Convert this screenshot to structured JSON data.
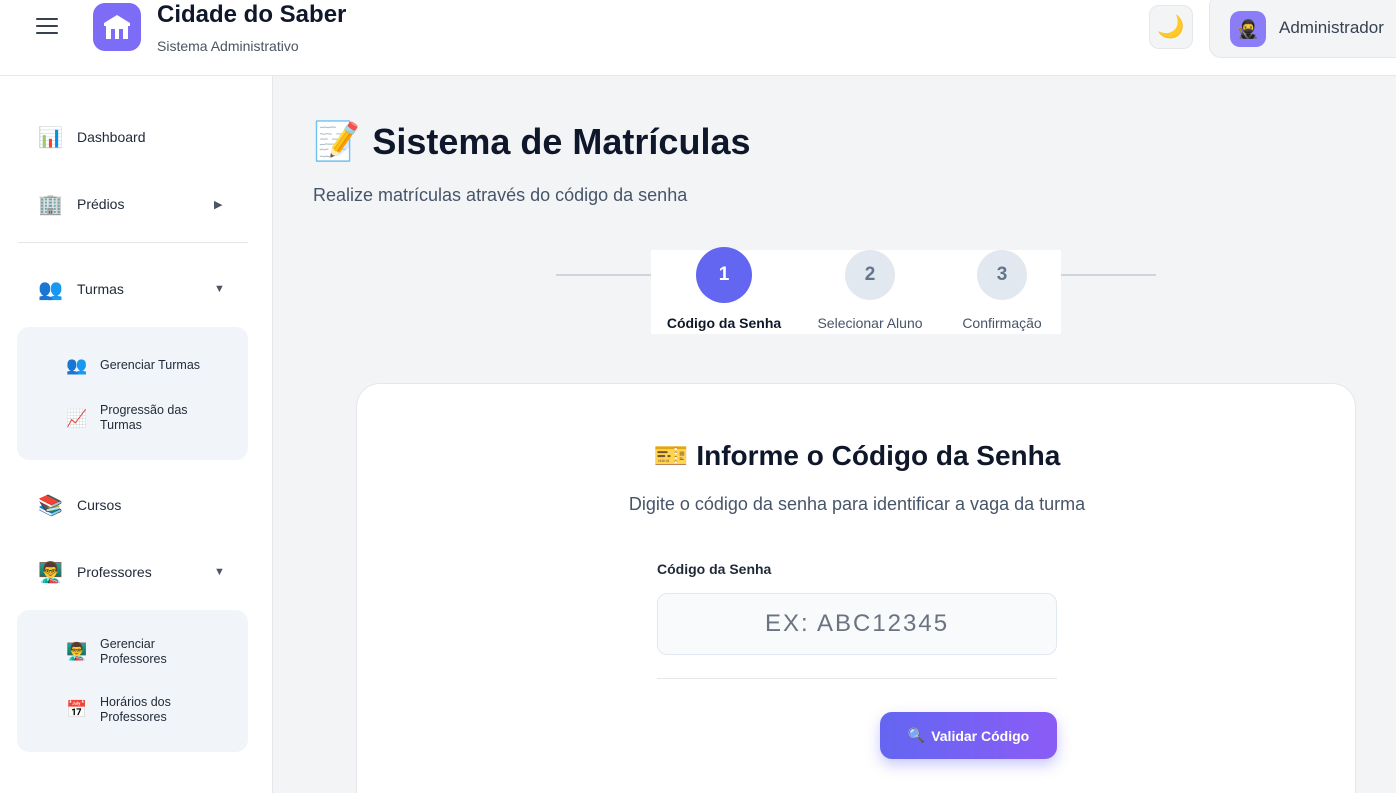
{
  "header": {
    "title": "Cidade do Saber",
    "subtitle": "Sistema Administrativo",
    "theme_icon": "🌙",
    "user": {
      "name": "Administrador",
      "avatar_icon": "🥷"
    }
  },
  "sidebar": {
    "items": [
      {
        "icon": "📊",
        "label": "Dashboard",
        "arrow": ""
      },
      {
        "icon": "🏢",
        "label": "Prédios",
        "arrow": "▶"
      },
      {
        "icon": "👥",
        "label": "Turmas",
        "arrow": "▼"
      },
      {
        "icon": "📚",
        "label": "Cursos",
        "arrow": ""
      },
      {
        "icon": "👨‍🏫",
        "label": "Professores",
        "arrow": "▼"
      }
    ],
    "turmas_submenu": [
      {
        "icon": "👥",
        "label": "Gerenciar Turmas"
      },
      {
        "icon": "📈",
        "label": "Progressão das Turmas"
      }
    ],
    "professores_submenu": [
      {
        "icon": "👨‍🏫",
        "label": "Gerenciar Professores"
      },
      {
        "icon": "📅",
        "label": "Horários dos Professores"
      }
    ]
  },
  "main": {
    "title_icon": "📝",
    "title": "Sistema de Matrículas",
    "subtitle": "Realize matrículas através do código da senha",
    "steps": [
      {
        "number": "1",
        "label": "Código da Senha",
        "active": true
      },
      {
        "number": "2",
        "label": "Selecionar Aluno",
        "active": false
      },
      {
        "number": "3",
        "label": "Confirmação",
        "active": false
      }
    ],
    "card": {
      "title_icon": "🎫",
      "title": "Informe o Código da Senha",
      "subtitle": "Digite o código da senha para identificar a vaga da turma",
      "field_label": "Código da Senha",
      "field_placeholder": "EX: ABC12345",
      "field_value": "",
      "button_icon": "🔍",
      "button_label": "Validar Código"
    }
  },
  "colors": {
    "accent": "#6366f1",
    "accent_secondary": "#8b5cf6",
    "logo": "#7c6cf6"
  }
}
